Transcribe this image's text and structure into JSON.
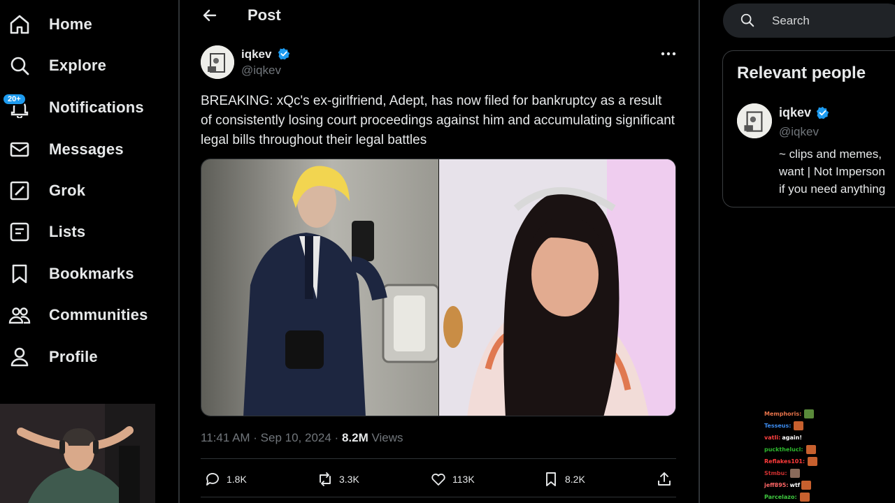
{
  "nav": {
    "items": [
      {
        "label": "Home",
        "icon": "home-icon"
      },
      {
        "label": "Explore",
        "icon": "search-icon"
      },
      {
        "label": "Notifications",
        "icon": "bell-icon",
        "badge": "20+"
      },
      {
        "label": "Messages",
        "icon": "envelope-icon"
      },
      {
        "label": "Grok",
        "icon": "grok-icon"
      },
      {
        "label": "Lists",
        "icon": "list-icon"
      },
      {
        "label": "Bookmarks",
        "icon": "bookmark-icon"
      },
      {
        "label": "Communities",
        "icon": "people-icon"
      },
      {
        "label": "Profile",
        "icon": "person-icon"
      }
    ]
  },
  "header": {
    "title": "Post"
  },
  "post": {
    "author_name": "iqkev",
    "author_handle": "@iqkev",
    "text": "BREAKING: xQc's ex-girlfriend, Adept, has now filed for bankruptcy as a result of consistently losing court proceedings against him and accumulating significant legal bills throughout their legal battles",
    "timestamp": "11:41 AM · Sep 10, 2024 · ",
    "views_count": "8.2M",
    "views_label": " Views",
    "replies": "1.8K",
    "reposts": "3.3K",
    "likes": "113K",
    "bookmarks": "8.2K"
  },
  "search": {
    "placeholder": "Search"
  },
  "relevant_people": {
    "title": "Relevant people",
    "name": "iqkev",
    "handle": "@iqkev",
    "bio_lines": [
      "~ clips and memes,",
      "want | Not Imperson",
      "if you need anything"
    ]
  },
  "chat": [
    {
      "user": "Memphoris:",
      "color": "#e8734a",
      "msg": "",
      "emote": true
    },
    {
      "user": "Tesseus:",
      "color": "#3c8cf0",
      "msg": "",
      "emote": true
    },
    {
      "user": "vatIi:",
      "color": "#ff4040",
      "msg": "again!",
      "emote": false
    },
    {
      "user": "puckthelucl:",
      "color": "#2eb82e",
      "msg": "",
      "emote": true
    },
    {
      "user": "Reflakes101:",
      "color": "#ff3b3b",
      "msg": "",
      "emote": true
    },
    {
      "user": "Stmbu:",
      "color": "#d03030",
      "msg": "",
      "emote": true
    },
    {
      "user": "jeff895:",
      "color": "#ff6666",
      "msg": "wtf",
      "emote": true
    },
    {
      "user": "Parcelazo:",
      "color": "#3fc93f",
      "msg": "",
      "emote": true
    }
  ],
  "colors": {
    "accent": "#1d9bf0",
    "background": "#000000",
    "muted": "#71767b",
    "text": "#e7e9ea"
  }
}
